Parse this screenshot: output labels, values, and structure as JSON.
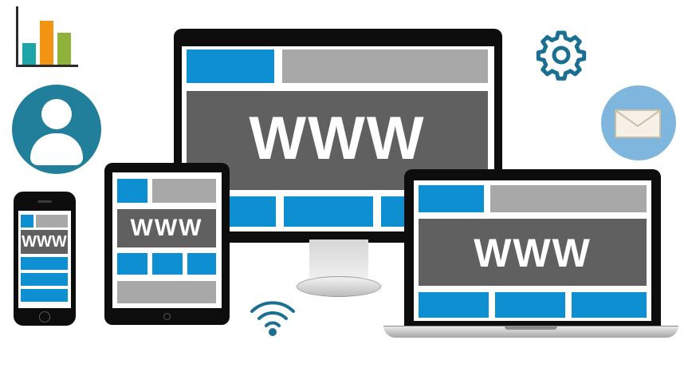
{
  "colors": {
    "accent_blue": "#0e8fd1",
    "user_circle": "#217f9b",
    "mail_circle": "#7fb6de",
    "gear": "#1a6f93",
    "chart_teal": "#1ea5a9",
    "chart_orange": "#f39312",
    "chart_green": "#8fb33a"
  },
  "icons": {
    "chart": "bar-chart-icon",
    "user": "user-icon",
    "gear": "gear-icon",
    "mail": "mail-icon",
    "wifi": "wifi-icon"
  },
  "chart_bars": [
    {
      "color": "#1ea5a9",
      "level": 0.38
    },
    {
      "color": "#f39312",
      "level": 0.77
    },
    {
      "color": "#8fb33a",
      "level": 0.57
    }
  ],
  "monitor": {
    "screen_text": "WWW"
  },
  "tablet": {
    "screen_text": "WWW"
  },
  "phone": {
    "screen_text": "WWW"
  },
  "laptop": {
    "screen_text": "WWW"
  }
}
